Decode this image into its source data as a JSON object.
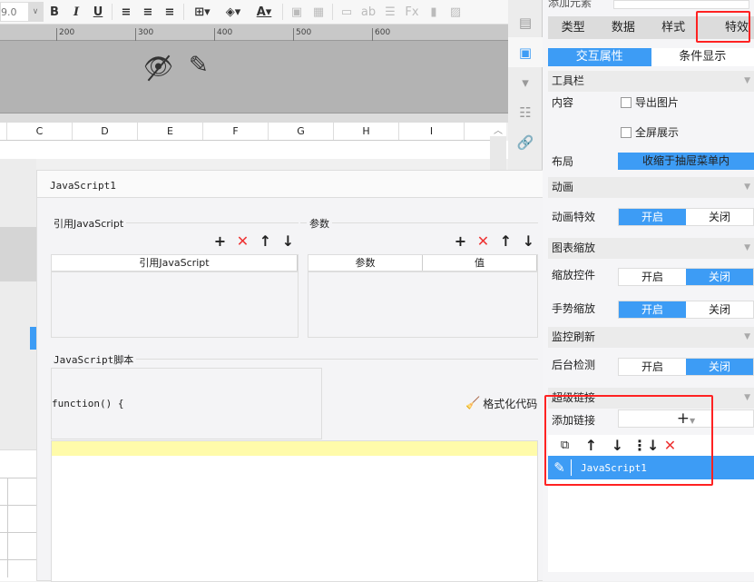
{
  "toolbar": {
    "font_size": "9.0",
    "bold": "B",
    "italic": "I",
    "underline": "U"
  },
  "ruler": {
    "ticks": [
      "200",
      "300",
      "400",
      "500",
      "600"
    ]
  },
  "columns": [
    "C",
    "D",
    "E",
    "F",
    "G",
    "H",
    "I"
  ],
  "dialog": {
    "title": "JavaScript1",
    "ref_js_legend": "引用JavaScript",
    "params_legend": "参数",
    "ref_js_header": "引用JavaScript",
    "params_headers": [
      "参数",
      "值"
    ],
    "script_legend": "JavaScript脚本",
    "code_prefix": "function() {",
    "format_code": "格式化代码"
  },
  "panel": {
    "top_label": "添加元素",
    "tabs": [
      "类型",
      "数据",
      "样式",
      "特效"
    ],
    "subtabs": [
      "交互属性",
      "条件显示"
    ],
    "toolbar_section": "工具栏",
    "content_label": "内容",
    "export_image": "导出图片",
    "fullscreen": "全屏展示",
    "layout_label": "布局",
    "layout_value": "收缩于抽屉菜单内",
    "animation_section": "动画",
    "animation_effect": "动画特效",
    "zoom_section": "图表缩放",
    "zoom_control": "缩放控件",
    "gesture_zoom": "手势缩放",
    "monitor_section": "监控刷新",
    "background_check": "后台检测",
    "hyperlink_section": "超级链接",
    "add_link": "添加链接",
    "on": "开启",
    "off": "关闭",
    "link_item": "JavaScript1"
  },
  "colors": {
    "accent": "#3d9cf5",
    "highlight": "#ff2222"
  }
}
